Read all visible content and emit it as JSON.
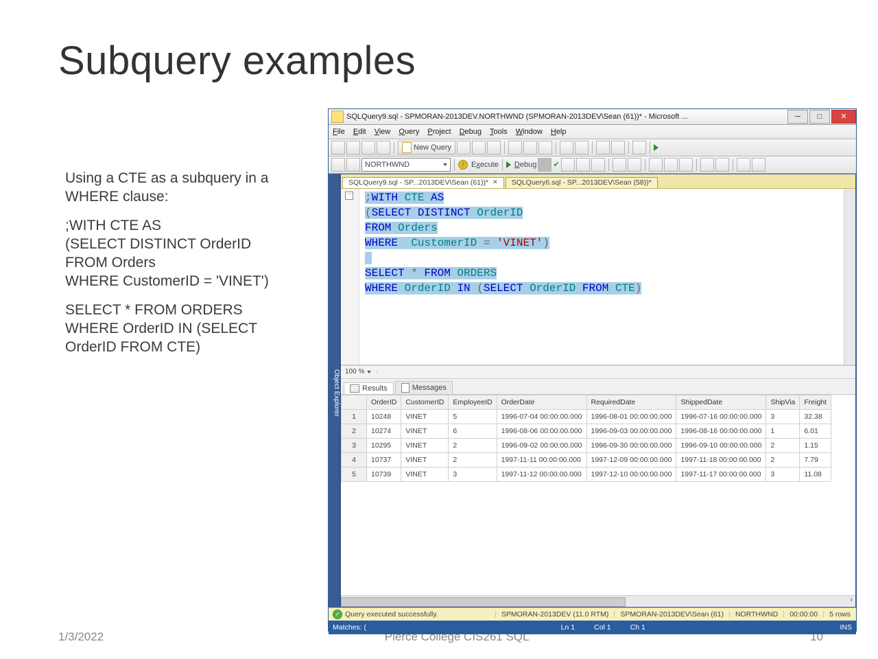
{
  "slide": {
    "title": "Subquery examples",
    "body_intro": "Using a CTE as a subquery in a WHERE clause:",
    "sql_block1_l1": ";WITH CTE AS",
    "sql_block1_l2": "(SELECT DISTINCT OrderID",
    "sql_block1_l3": "FROM Orders",
    "sql_block1_l4": "WHERE CustomerID = 'VINET')",
    "sql_block2_l1": "SELECT * FROM ORDERS",
    "sql_block2_l2": "WHERE OrderID IN (SELECT OrderID FROM CTE)"
  },
  "footer": {
    "date": "1/3/2022",
    "course": "Pierce College CIS261 SQL",
    "page": "10"
  },
  "ssms": {
    "title": "SQLQuery9.sql - SPMORAN-2013DEV.NORTHWND (SPMORAN-2013DEV\\Sean (61))* - Microsoft ...",
    "menus": [
      "File",
      "Edit",
      "View",
      "Query",
      "Project",
      "Debug",
      "Tools",
      "Window",
      "Help"
    ],
    "newQuery": "New Query",
    "database": "NORTHWND",
    "execute": "Execute",
    "debug": "Debug",
    "tabs": {
      "active": "SQLQuery9.sql - SP...2013DEV\\Sean (61))*",
      "inactive": "SQLQuery6.sql - SP...2013DEV\\Sean (58))*"
    },
    "objectExplorer": "Object Explorer",
    "zoom": "100 %",
    "resultTabs": {
      "results": "Results",
      "messages": "Messages"
    },
    "columns": [
      "OrderID",
      "CustomerID",
      "EmployeeID",
      "OrderDate",
      "RequiredDate",
      "ShippedDate",
      "ShipVia",
      "Freight"
    ],
    "rows": [
      {
        "n": "1",
        "OrderID": "10248",
        "CustomerID": "VINET",
        "EmployeeID": "5",
        "OrderDate": "1996-07-04 00:00:00.000",
        "RequiredDate": "1996-08-01 00:00:00.000",
        "ShippedDate": "1996-07-16 00:00:00.000",
        "ShipVia": "3",
        "Freight": "32.38"
      },
      {
        "n": "2",
        "OrderID": "10274",
        "CustomerID": "VINET",
        "EmployeeID": "6",
        "OrderDate": "1996-08-06 00:00:00.000",
        "RequiredDate": "1996-09-03 00:00:00.000",
        "ShippedDate": "1996-08-16 00:00:00.000",
        "ShipVia": "1",
        "Freight": "6.01"
      },
      {
        "n": "3",
        "OrderID": "10295",
        "CustomerID": "VINET",
        "EmployeeID": "2",
        "OrderDate": "1996-09-02 00:00:00.000",
        "RequiredDate": "1996-09-30 00:00:00.000",
        "ShippedDate": "1996-09-10 00:00:00.000",
        "ShipVia": "2",
        "Freight": "1.15"
      },
      {
        "n": "4",
        "OrderID": "10737",
        "CustomerID": "VINET",
        "EmployeeID": "2",
        "OrderDate": "1997-11-11 00:00:00.000",
        "RequiredDate": "1997-12-09 00:00:00.000",
        "ShippedDate": "1997-11-18 00:00:00.000",
        "ShipVia": "2",
        "Freight": "7.79"
      },
      {
        "n": "5",
        "OrderID": "10739",
        "CustomerID": "VINET",
        "EmployeeID": "3",
        "OrderDate": "1997-11-12 00:00:00.000",
        "RequiredDate": "1997-12-10 00:00:00.000",
        "ShippedDate": "1997-11-17 00:00:00.000",
        "ShipVia": "3",
        "Freight": "11.08"
      }
    ],
    "status": {
      "msg": "Query executed successfully.",
      "server": "SPMORAN-2013DEV (11.0 RTM)",
      "user": "SPMORAN-2013DEV\\Sean (61)",
      "db": "NORTHWND",
      "time": "00:00:00",
      "rows": "5 rows"
    },
    "bluebar": {
      "matches": "Matches: (",
      "ln": "Ln 1",
      "col": "Col 1",
      "ch": "Ch 1",
      "ins": "INS"
    }
  },
  "editor_lines": [
    {
      "pre": "",
      "t": [
        [
          ";",
          "op"
        ],
        [
          "WITH",
          "kw"
        ],
        [
          " CTE ",
          "fn"
        ],
        [
          "AS",
          "kw"
        ]
      ]
    },
    {
      "pre": "",
      "t": [
        [
          "(",
          "op"
        ],
        [
          "SELECT DISTINCT",
          "kw"
        ],
        [
          " OrderID",
          "fn"
        ]
      ]
    },
    {
      "pre": "",
      "t": [
        [
          "FROM",
          "kw"
        ],
        [
          " Orders",
          "fn"
        ]
      ]
    },
    {
      "pre": "",
      "t": [
        [
          "WHERE",
          "kw"
        ],
        [
          "  CustomerID ",
          "fn"
        ],
        [
          "=",
          "op"
        ],
        [
          " ",
          "op"
        ],
        [
          "'VINET'",
          "str"
        ],
        [
          ")",
          "op"
        ]
      ]
    },
    {
      "pre": "",
      "t": []
    },
    {
      "pre": "",
      "t": [
        [
          "SELECT",
          "kw"
        ],
        [
          " * ",
          "op"
        ],
        [
          "FROM",
          "kw"
        ],
        [
          " ORDERS",
          "fn"
        ]
      ]
    },
    {
      "pre": "",
      "t": [
        [
          "WHERE",
          "kw"
        ],
        [
          " OrderID ",
          "fn"
        ],
        [
          "IN ",
          "kw"
        ],
        [
          "(",
          "op"
        ],
        [
          "SELECT",
          "kw"
        ],
        [
          " OrderID ",
          "fn"
        ],
        [
          "FROM",
          "kw"
        ],
        [
          " CTE",
          "fn"
        ],
        [
          ")",
          "op"
        ]
      ]
    }
  ]
}
